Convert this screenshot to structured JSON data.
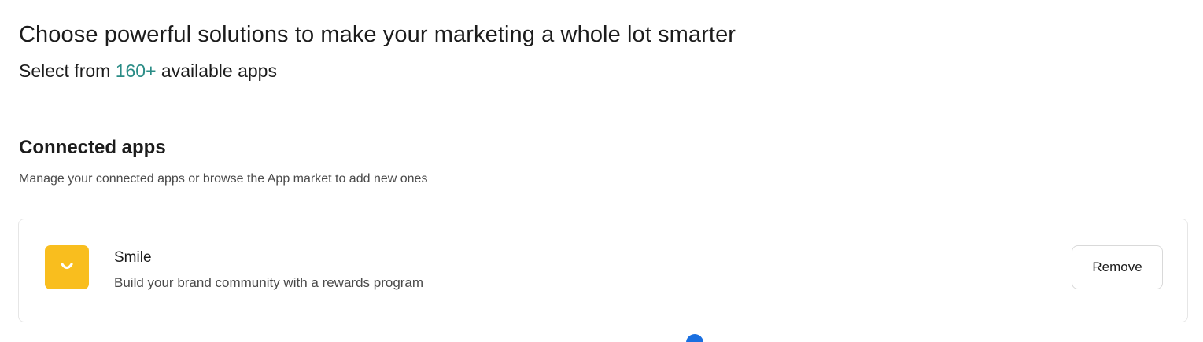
{
  "hero": {
    "title": "Choose powerful solutions to make your marketing a whole lot smarter",
    "subtitle_prefix": "Select from ",
    "subtitle_count": "160+",
    "subtitle_suffix": " available apps"
  },
  "connected_apps": {
    "title": "Connected apps",
    "description": "Manage your connected apps or browse the App market to add new ones",
    "apps": [
      {
        "name": "Smile",
        "description": "Build your brand community with a rewards program",
        "logo_icon": "smile-logo-icon",
        "logo_color": "#f9be1e",
        "action_label": "Remove"
      }
    ]
  },
  "colors": {
    "accent": "#2a8c86",
    "indicator": "#1a6fe0"
  }
}
